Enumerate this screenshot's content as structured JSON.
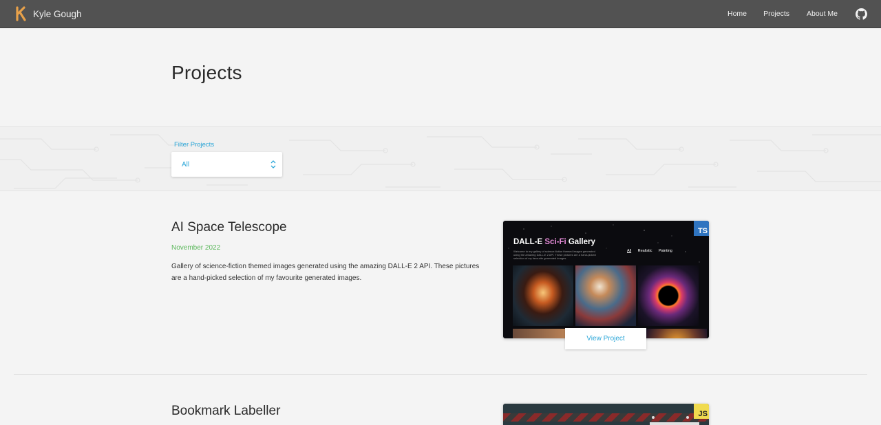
{
  "navbar": {
    "brand_name": "Kyle Gough",
    "links": [
      "Home",
      "Projects",
      "About Me"
    ],
    "github_icon": "github-icon",
    "colors": {
      "background": "#525252",
      "logo": "#e8a14a"
    }
  },
  "page": {
    "title": "Projects"
  },
  "filter": {
    "label": "Filter Projects",
    "value": "All"
  },
  "projects": [
    {
      "title": "AI Space Telescope",
      "date": "November 2022",
      "description": "Gallery of science-fiction themed images generated using the amazing DALL-E 2 API. These pictures are a hand-picked selection of my favourite generated images.",
      "badge": "TS",
      "action": "View Project",
      "preview": {
        "title_prefix": "DALL-E ",
        "title_accent": "Sci-Fi",
        "title_suffix": " Gallery",
        "subtitle": "Welcome to my gallery of science-fiction themed images generated using the amazing DALL-E 2 API. These pictures are a hand-picked selection of my favourite generated images.",
        "tabs": [
          "All",
          "Realistic",
          "Painting"
        ]
      }
    },
    {
      "title": "Bookmark Labeller",
      "badge": "JS"
    }
  ],
  "colors": {
    "accent": "#2aa6d8",
    "date": "#5cb85c",
    "ts_badge": "#2f74c0",
    "js_badge": "#f0db4f"
  }
}
